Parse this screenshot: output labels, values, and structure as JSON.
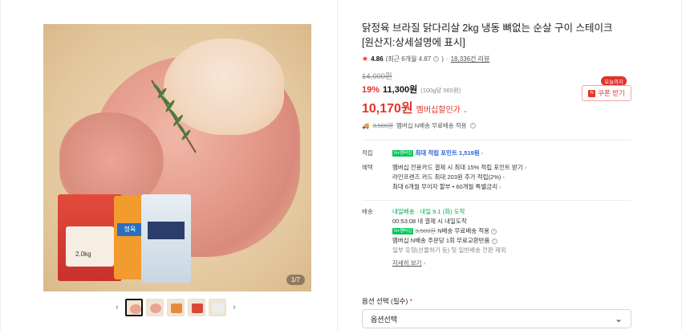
{
  "gallery": {
    "counter": "1/7",
    "package_label": "정육",
    "package_weight": "2.0kg",
    "prev_icon": "chevron-left-icon",
    "next_icon": "chevron-right-icon"
  },
  "product": {
    "title_line1": "닭정육 브라질 닭다리살 2kg 냉동 뼈없는 순살 구이 스테이크",
    "title_line2": "[원산지:상세설명에 표시]",
    "rating_score": "4.86",
    "rating_recent": "(최근 6개월 4.87",
    "rating_close": ")",
    "reviews": "18,336건 리뷰",
    "original_price": "14,000원",
    "discount": "19%",
    "price": "11,300원",
    "unit_price": "(100g당 565원)",
    "member_price": "10,170원",
    "member_label": "멤버십할인가",
    "ship_strike": "3,500원",
    "ship_text": "멤버십 N배송 무료배송 적용",
    "coupon_badge": "오늘까지",
    "coupon_label": "쿠폰 받기",
    "accent_color": "#e4322b"
  },
  "points": {
    "label": "적립",
    "npay": "N+멤버십",
    "text": "최대 적립 포인트",
    "value": "1,519원"
  },
  "benefits": {
    "label": "혜택",
    "line1": "멤버십 전용카드 결제 시 최대 15% 적립 포인트 받기",
    "line2": "라인프렌즈 카드 최대 203원 추가 적립(2%)",
    "line3": "최대 6개월 무이자 할부 • 60개월 특별금리"
  },
  "delivery": {
    "label": "배송",
    "tag": "내일배송",
    "arrival": "내일 9.1 (화) 도착",
    "cutoff": "00:53:08",
    "cutoff_text": "내 결제 시 내일도착",
    "npay": "N+멤버십",
    "strike": "3,500원",
    "free_text": "N배송 무료배송 적용",
    "return_text": "멤버십 N배송 주문당 1회 무료교환반품",
    "note": "일부 유형(선물하기 등) 및 일반배송 전환 제외",
    "detail_link": "자세히 보기"
  },
  "options": {
    "label": "옵션 선택",
    "required": "(필수)",
    "asterisk": "*",
    "select_value": "옵션선택"
  }
}
